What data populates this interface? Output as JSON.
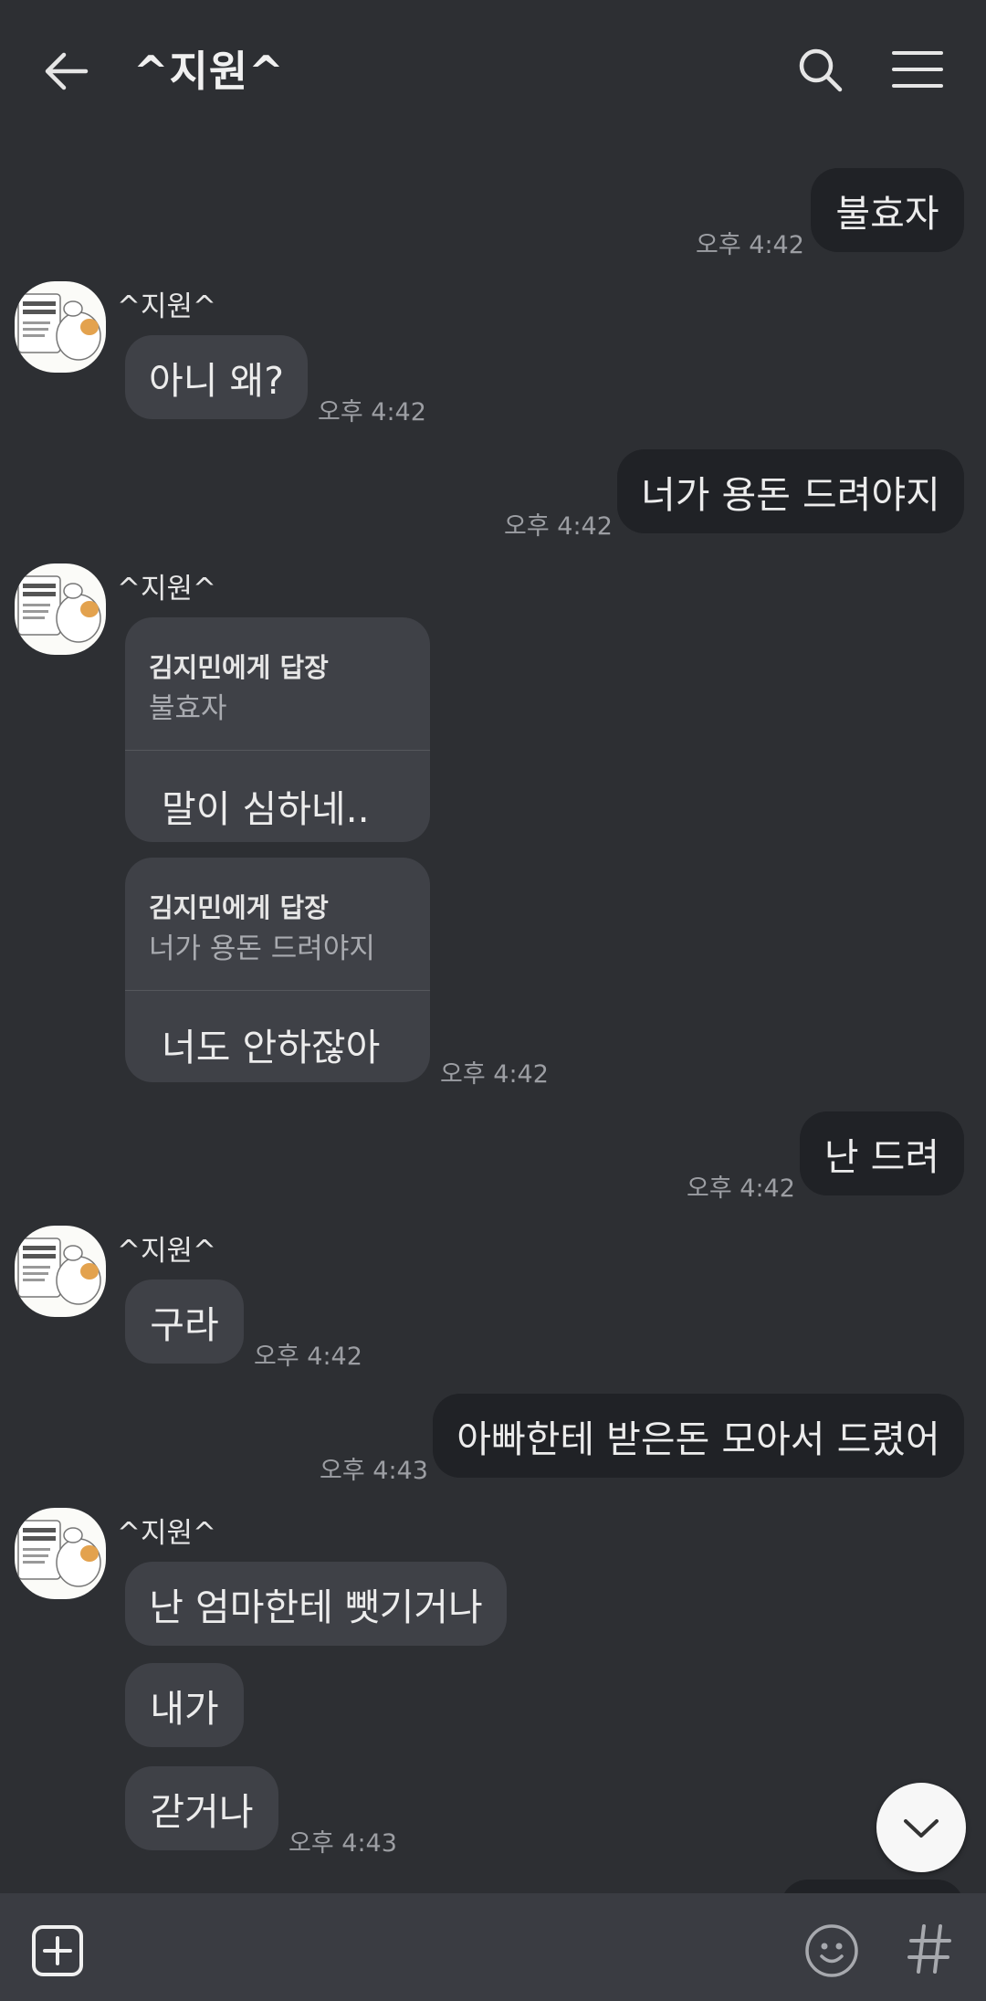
{
  "header": {
    "title": "^지원^"
  },
  "contact_name": "^지원^",
  "messages": {
    "m1": {
      "text": "불효자",
      "time": "오후 4:42"
    },
    "m2": {
      "text": "아니 왜?",
      "time": "오후 4:42"
    },
    "m3": {
      "text": "너가 용돈 드려야지",
      "time": "오후 4:42"
    },
    "m4": {
      "reply_to": "김지민에게 답장",
      "quote": "불효자",
      "text": "말이 심하네.."
    },
    "m5": {
      "reply_to": "김지민에게 답장",
      "quote": "너가 용돈 드려야지",
      "text": "너도 안하잖아",
      "time": "오후 4:42"
    },
    "m6": {
      "text": "난 드려",
      "time": "오후 4:42"
    },
    "m7": {
      "text": "구라",
      "time": "오후 4:42"
    },
    "m8": {
      "text": "아빠한테 받은돈 모아서 드렸어",
      "time": "오후 4:43"
    },
    "m9": {
      "text": "난 엄마한테 뺏기거나"
    },
    "m10": {
      "text": "내가"
    },
    "m11": {
      "text": "갇거나",
      "time": "오후 4:43"
    }
  },
  "avatar_image_text": "분실물 찾습니다",
  "icons": {
    "back": "arrow-left-icon",
    "search": "search-icon",
    "menu": "hamburger-menu-icon",
    "scroll_down": "chevron-down-icon",
    "attach": "plus-square-icon",
    "emoji": "smiley-icon",
    "hashtag": "hashtag-icon"
  },
  "colors": {
    "background": "#2d2f33",
    "incoming_bubble": "#3f4147",
    "outgoing_bubble": "#202226",
    "bottom_bar": "#3a3c42"
  }
}
